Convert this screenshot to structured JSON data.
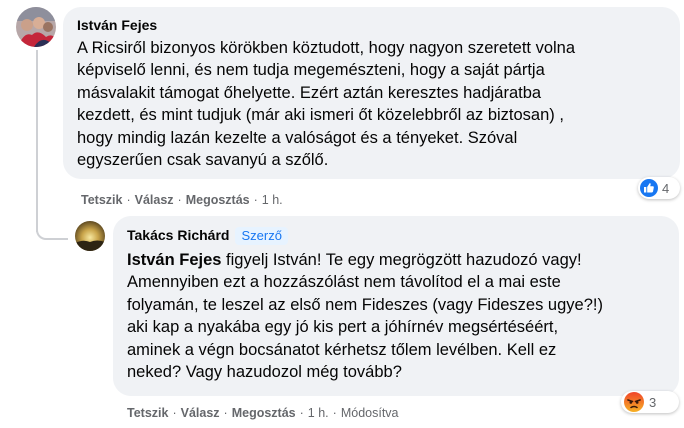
{
  "comments": [
    {
      "author": "István Fejes",
      "lines": [
        "A Ricsiről bizonyos körökben köztudott, hogy nagyon szeretett volna",
        "képviselő lenni, és nem tudja megemészteni, hogy a saját pártja",
        "másvalakit támogat őhelyette. Ezért aztán keresztes hadjáratba",
        "kezdett, és mint tudjuk (már aki ismeri őt közelebbről az biztosan) ,",
        "hogy mindig lazán kezelte a valóságot és a tényeket. Szóval",
        "egyszerűen csak savanyú a szőlő."
      ],
      "actions": {
        "like": "Tetszik",
        "reply": "Válasz",
        "share": "Megosztás",
        "time": "1 h."
      },
      "reaction_count": "4",
      "reaction_icon": "like-icon",
      "colors": {
        "like_blue": "#1877f2"
      }
    },
    {
      "author": "Takács Richárd",
      "author_badge": "Szerző",
      "mention": "István Fejes",
      "first_line_rest": " figyelj István! Te egy megrögzött hazudozó vagy!",
      "lines": [
        "Amennyiben ezt a hozzászólást nem távolítod el a mai este",
        "folyamán, te leszel az első nem Fideszes (vagy Fideszes ugye?!)",
        "aki kap a nyakába egy jó kis pert a jóhírnév megsértéséért,",
        "aminek a végn bocsánatot kérhetsz tőlem levélben. Kell ez",
        "neked? Vagy hazudozol még tovább?"
      ],
      "actions": {
        "like": "Tetszik",
        "reply": "Válasz",
        "share": "Megosztás",
        "time": "1 h.",
        "edited": "Módosítva"
      },
      "reaction_count": "3",
      "reaction_icon": "angry-icon",
      "colors": {
        "angry_top": "#f0442a",
        "angry_bottom": "#f7b125"
      }
    }
  ]
}
